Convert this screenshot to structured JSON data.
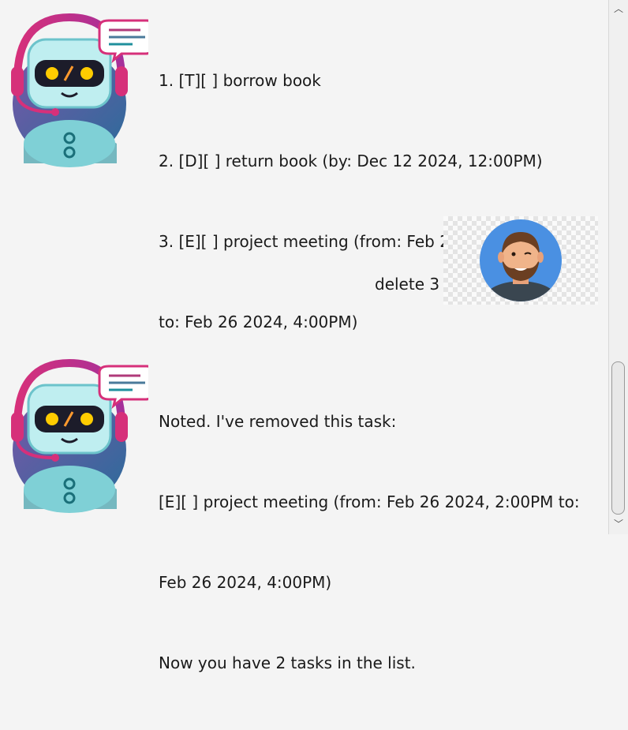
{
  "dialogs": [
    {
      "speaker": "bot",
      "lines": [
        "1. [T][ ] borrow book",
        "2. [D][ ] return book (by: Dec 12 2024, 12:00PM)",
        "3. [E][ ] project meeting (from: Feb 26 2024, 2:00PM",
        "to: Feb 26 2024, 4:00PM)"
      ]
    },
    {
      "speaker": "user",
      "lines": [
        "delete 3"
      ]
    },
    {
      "speaker": "bot",
      "lines": [
        "Noted. I've removed this task:",
        "[E][ ] project meeting (from: Feb 26 2024, 2:00PM to:",
        "Feb 26 2024, 4:00PM)",
        "Now you have 2 tasks in the list."
      ]
    }
  ],
  "scrollbar": {
    "up_icon": "chevron-up-icon",
    "down_icon": "chevron-down-icon"
  },
  "colors": {
    "background": "#f4f4f4",
    "text": "#1a1a1a",
    "bot_headset": "#c2306e",
    "user_avatar_bg": "#4a90e2"
  }
}
